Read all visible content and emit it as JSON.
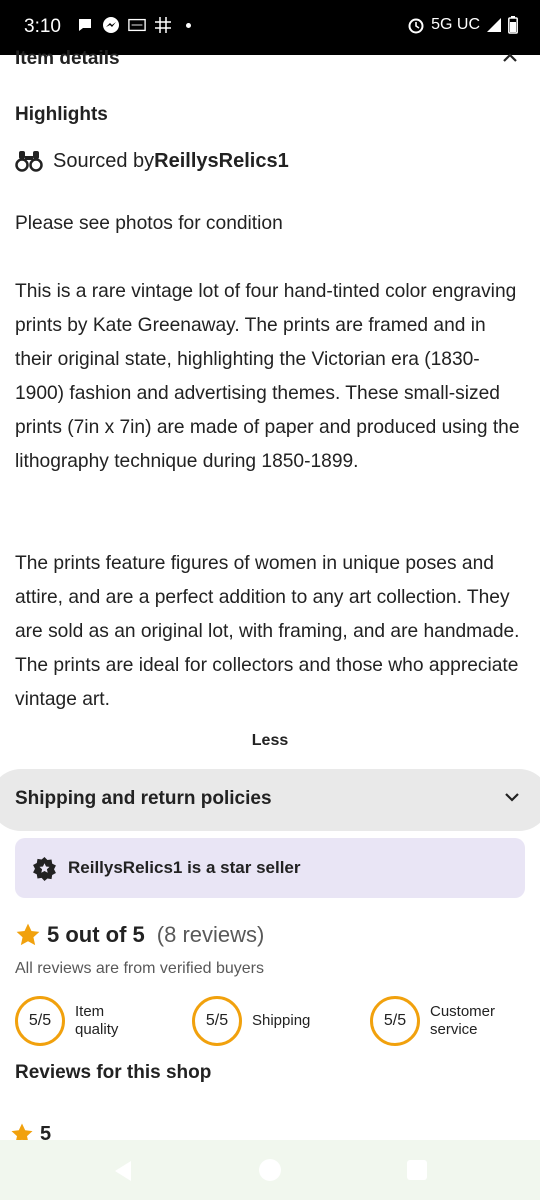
{
  "status_bar": {
    "time": "3:10",
    "network": "5G UC",
    "icons": [
      "chat-bubble-icon",
      "messenger-icon",
      "temu-icon",
      "grid-app-icon",
      "alarm-icon",
      "signal-icon",
      "battery-icon"
    ]
  },
  "item_details": {
    "title": "Item details"
  },
  "highlights": {
    "title": "Highlights",
    "sourced_prefix": "Sourced by ",
    "shop_name": "ReillysRelics1"
  },
  "description": {
    "p1": "Please see photos for condition",
    "p2": "This is a rare vintage lot of four hand-tinted color engraving prints by Kate Greenaway. The prints are framed and in their original state, highlighting the Victorian era (1830-1900) fashion and advertising themes. These small-sized prints (7in x 7in) are made of paper and produced using the lithography technique during 1850-1899.",
    "p3": "The prints feature figures of women in unique poses and attire, and are a perfect addition to any art collection. They are sold as an original lot, with framing, and are handmade. The prints are ideal for collectors and those who appreciate vintage art.",
    "less_label": "Less"
  },
  "shipping": {
    "label": "Shipping and return policies"
  },
  "star_seller": {
    "text": "ReillysRelics1 is a star seller"
  },
  "rating": {
    "summary": "5 out of 5",
    "count": "(8 reviews)",
    "verified": "All reviews are from verified buyers"
  },
  "scores": [
    {
      "value": "5/5",
      "label_line1": "Item",
      "label_line2": "quality"
    },
    {
      "value": "5/5",
      "label_line1": "Shipping",
      "label_line2": ""
    },
    {
      "value": "5/5",
      "label_line1": "Customer",
      "label_line2": "service"
    }
  ],
  "reviews": {
    "title": "Reviews for this shop",
    "first_rating": "5"
  },
  "colors": {
    "accent_star": "#f1a10d",
    "star_seller_bg": "#e9e5f5",
    "shipping_bg": "#e9e9e9",
    "nav_bg": "#f1f7ee"
  }
}
